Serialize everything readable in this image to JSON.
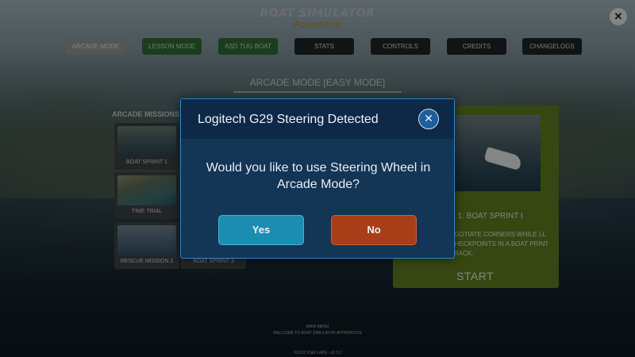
{
  "header": {
    "logo_line1": "BOAT SIMULATOR",
    "logo_line2": "Apprentice",
    "close_symbol": "✕"
  },
  "nav": {
    "items": [
      {
        "label": "ARCADE MODE",
        "state": "active"
      },
      {
        "label": "LESSON MODE",
        "state": "green"
      },
      {
        "label": "ASD TUG BOAT",
        "state": "green"
      },
      {
        "label": "STATS",
        "state": "normal"
      },
      {
        "label": "CONTROLS",
        "state": "normal"
      },
      {
        "label": "CREDITS",
        "state": "normal"
      },
      {
        "label": "CHANGELOGS",
        "state": "normal"
      }
    ]
  },
  "mode_title": "ARCADE MODE [EASY MODE]",
  "missions": {
    "label": "ARCADE MISSIONS",
    "cards": [
      {
        "label": "BOAT SPRINT 1"
      },
      {
        "label": "TIME TRIAL"
      },
      {
        "label": "RESCUE MISSION 2"
      },
      {
        "label": "BOAT SPRINT 3"
      }
    ]
  },
  "detail": {
    "title": "E 1: BOAT SPRINT I",
    "description": "EGOTIATE CORNERS WHILE LL CHECKPOINTS IN A BOAT PRINT TRACK.",
    "start_label": "START"
  },
  "footer": {
    "line1": "MAIN MENU",
    "line2": "WELCOME TO BOAT SIMULATOR APPRENTICE",
    "copyright": "©2022 VSEI LABS - v2.3.2"
  },
  "modal": {
    "title": "Logitech G29 Steering Detected",
    "close_symbol": "✕",
    "message": "Would you like to use Steering Wheel in Arcade Mode?",
    "yes_label": "Yes",
    "no_label": "No"
  },
  "colors": {
    "modal_bg": "#133556",
    "modal_border": "#2c86c9",
    "yes_button": "#1b8db0",
    "no_button": "#a73e18",
    "nav_green": "#2f6a32",
    "detail_panel": "#5d7a20"
  }
}
